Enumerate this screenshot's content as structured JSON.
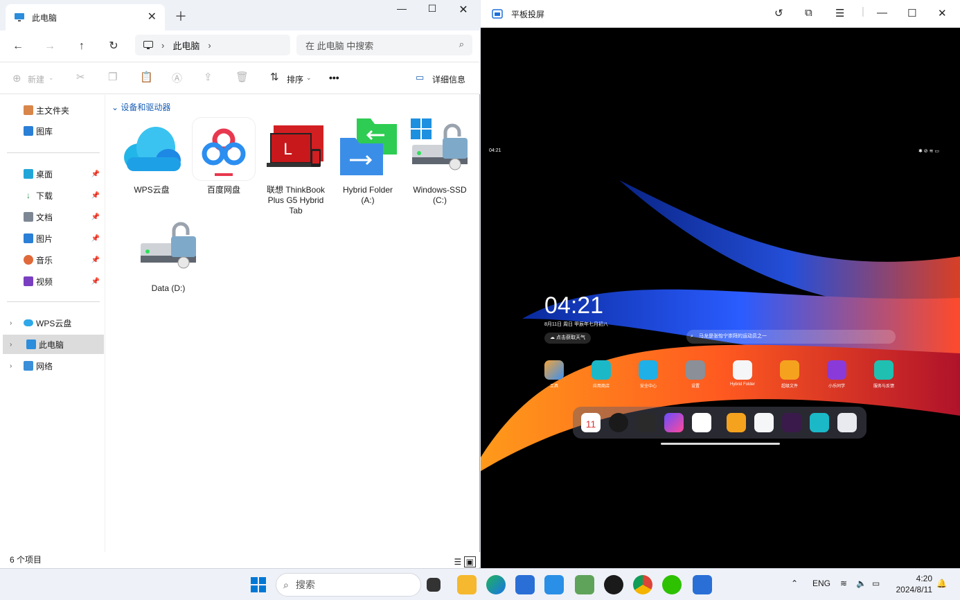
{
  "explorer": {
    "tab_title": "此电脑",
    "address": {
      "segment": "此电脑"
    },
    "search_placeholder": "在 此电脑 中搜索",
    "commands": {
      "new": "新建",
      "sort": "排序",
      "more": "•••",
      "details": "详细信息"
    },
    "sidebar": {
      "quick": [
        {
          "label": "主文件夹"
        },
        {
          "label": "图库"
        }
      ],
      "pinned": [
        {
          "label": "桌面"
        },
        {
          "label": "下载"
        },
        {
          "label": "文档"
        },
        {
          "label": "图片"
        },
        {
          "label": "音乐"
        },
        {
          "label": "视频"
        }
      ],
      "tree": [
        {
          "label": "WPS云盘"
        },
        {
          "label": "此电脑"
        },
        {
          "label": "网络"
        }
      ]
    },
    "group_header": "设备和驱动器",
    "drives": [
      {
        "line1": "WPS云盘",
        "line2": "",
        "line3": ""
      },
      {
        "line1": "百度网盘",
        "line2": "",
        "line3": ""
      },
      {
        "line1": "联想 ThinkBook",
        "line2": "Plus G5 Hybrid",
        "line3": "Tab"
      },
      {
        "line1": "Hybrid Folder",
        "line2": "(A:)",
        "line3": ""
      },
      {
        "line1": "Windows-SSD",
        "line2": "(C:)",
        "line3": ""
      },
      {
        "line1": "Data (D:)",
        "line2": "",
        "line3": ""
      }
    ],
    "status": "6 个项目"
  },
  "projection": {
    "title": "平板投屏",
    "status_time": "04:21",
    "clock": "04:21",
    "date": "8月11日 周日 甲辰年七月初八",
    "weather": "点击获取天气",
    "search": "马龙是张怡宁崇拜的运动员之一",
    "apps": [
      {
        "label": "工具"
      },
      {
        "label": "应用商店"
      },
      {
        "label": "安全中心"
      },
      {
        "label": "设置"
      },
      {
        "label": "Hybrid Folder"
      },
      {
        "label": "超级文件"
      },
      {
        "label": "小乐同学"
      },
      {
        "label": "服务与反馈"
      }
    ],
    "calendar_day": "11",
    "calendar_week": "周日"
  },
  "taskbar": {
    "search": "搜索",
    "lang": "ENG",
    "time": "4:20",
    "date": "2024/8/11"
  }
}
